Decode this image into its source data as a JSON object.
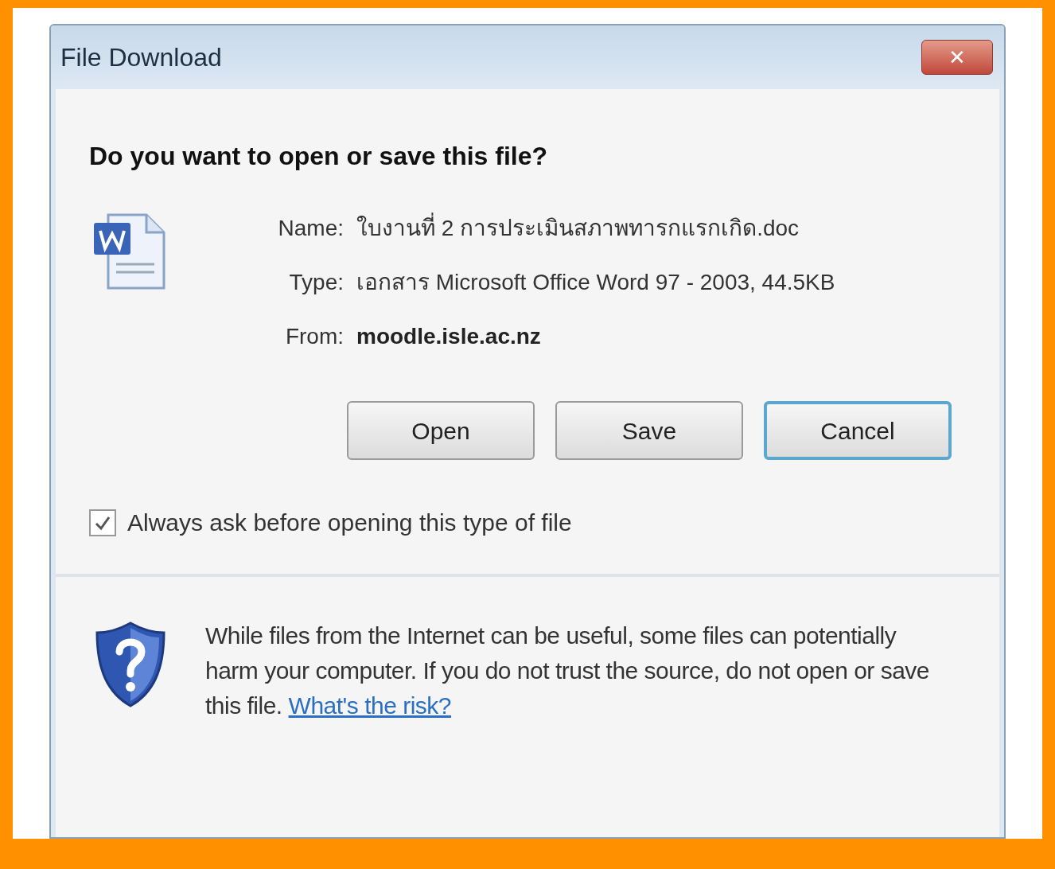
{
  "window": {
    "title": "File Download",
    "close_label": "✕"
  },
  "question": "Do you want to open or save this file?",
  "details": [
    {
      "label": "Name:",
      "value": "ใบงานที่ 2 การประเมินสภาพทารกแรกเกิด.doc",
      "bold": false
    },
    {
      "label": "Type:",
      "value": "เอกสาร Microsoft Office Word 97 - 2003, 44.5KB",
      "bold": false
    },
    {
      "label": "From:",
      "value": "moodle.isle.ac.nz",
      "bold": true
    }
  ],
  "buttons": [
    {
      "label": "Open",
      "focused": false
    },
    {
      "label": "Save",
      "focused": false
    },
    {
      "label": "Cancel",
      "focused": true
    }
  ],
  "always_ask": {
    "label": "Always ask before opening this type of file",
    "checked": true
  },
  "warning": {
    "text": "While files from the Internet can be useful, some files can potentially harm your computer. If you do not trust the source, do not open or save this file.",
    "link": "What's the risk?"
  }
}
